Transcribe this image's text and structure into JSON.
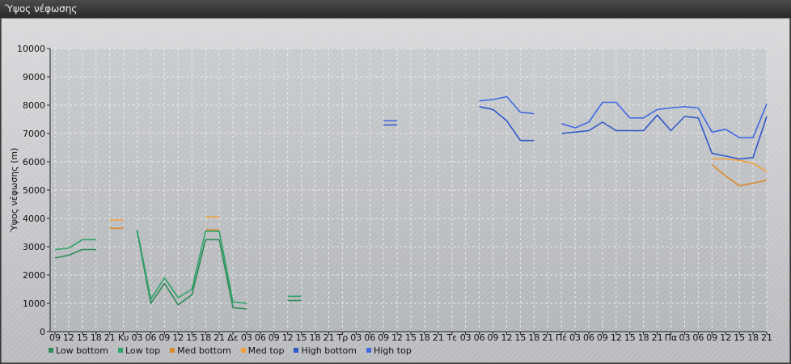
{
  "window": {
    "title": "Ύψος νέφωσης"
  },
  "chart_data": {
    "type": "line",
    "title": "",
    "ylabel": "Ύψος νέφωσης (m)",
    "xlabel": "",
    "ylim": [
      0,
      10000
    ],
    "yticks": [
      0,
      1000,
      2000,
      3000,
      4000,
      5000,
      6000,
      7000,
      8000,
      9000,
      10000
    ],
    "grid": true,
    "legend_position": "bottom-left",
    "x_labels": [
      "09",
      "12",
      "15",
      "18",
      "21",
      "Κυ",
      "03",
      "06",
      "09",
      "12",
      "15",
      "18",
      "21",
      "Δε",
      "03",
      "06",
      "09",
      "12",
      "15",
      "18",
      "21",
      "Τρ",
      "03",
      "06",
      "09",
      "12",
      "15",
      "18",
      "21",
      "Τε",
      "03",
      "06",
      "09",
      "12",
      "15",
      "18",
      "21",
      "Πέ",
      "03",
      "06",
      "09",
      "12",
      "15",
      "18",
      "21",
      "Πα",
      "03",
      "06",
      "09",
      "12",
      "15",
      "18",
      "21"
    ],
    "series": [
      {
        "name": "Low bottom",
        "color": "#2e8b57",
        "values": [
          2600,
          2700,
          2900,
          2900,
          null,
          null,
          3550,
          1000,
          1700,
          950,
          1300,
          3250,
          3250,
          850,
          800,
          null,
          null,
          1100,
          1100,
          null,
          null,
          null,
          null,
          null,
          null,
          null,
          null,
          null,
          null,
          null,
          null,
          null,
          null,
          null,
          null,
          null,
          null,
          null,
          null,
          null,
          null,
          null,
          null,
          null,
          null,
          null,
          null,
          null,
          null,
          null,
          null,
          null,
          null
        ]
      },
      {
        "name": "Low top",
        "color": "#2ea36a",
        "values": [
          2900,
          2950,
          3250,
          3250,
          null,
          null,
          3600,
          1150,
          1900,
          1200,
          1500,
          3550,
          3550,
          1050,
          1000,
          null,
          null,
          1250,
          1250,
          null,
          null,
          null,
          null,
          null,
          null,
          null,
          null,
          null,
          null,
          null,
          null,
          null,
          null,
          null,
          null,
          null,
          null,
          null,
          null,
          null,
          null,
          null,
          null,
          null,
          null,
          null,
          null,
          null,
          null,
          null,
          null,
          null,
          null
        ]
      },
      {
        "name": "Med bottom",
        "color": "#d98a2b",
        "values": [
          null,
          null,
          null,
          null,
          3650,
          3650,
          null,
          null,
          null,
          null,
          null,
          3600,
          3600,
          null,
          null,
          null,
          null,
          null,
          null,
          null,
          null,
          null,
          null,
          null,
          null,
          null,
          null,
          null,
          null,
          null,
          null,
          null,
          null,
          null,
          null,
          null,
          null,
          null,
          null,
          null,
          null,
          null,
          null,
          null,
          null,
          null,
          null,
          null,
          5900,
          5500,
          5150,
          5250,
          5350
        ]
      },
      {
        "name": "Med top",
        "color": "#f0a040",
        "values": [
          null,
          null,
          null,
          null,
          3950,
          3950,
          null,
          null,
          null,
          null,
          null,
          4050,
          4050,
          null,
          null,
          null,
          null,
          null,
          null,
          null,
          null,
          null,
          null,
          null,
          null,
          null,
          null,
          null,
          null,
          null,
          null,
          null,
          null,
          null,
          null,
          null,
          null,
          null,
          null,
          null,
          null,
          null,
          null,
          null,
          null,
          null,
          null,
          null,
          6100,
          6100,
          6050,
          5950,
          5650
        ]
      },
      {
        "name": "High bottom",
        "color": "#2f57c8",
        "values": [
          null,
          null,
          null,
          null,
          null,
          null,
          null,
          null,
          null,
          null,
          null,
          null,
          null,
          null,
          null,
          null,
          null,
          null,
          null,
          null,
          null,
          null,
          null,
          null,
          7300,
          7300,
          null,
          null,
          null,
          null,
          null,
          7950,
          7850,
          7450,
          6750,
          6750,
          null,
          7000,
          7050,
          7100,
          7400,
          7100,
          7100,
          7100,
          7650,
          7100,
          7600,
          7550,
          6300,
          6200,
          6100,
          6150,
          7600
        ]
      },
      {
        "name": "High top",
        "color": "#4169e1",
        "values": [
          null,
          null,
          null,
          null,
          null,
          null,
          null,
          null,
          null,
          null,
          null,
          null,
          null,
          null,
          null,
          null,
          null,
          null,
          null,
          null,
          null,
          null,
          null,
          null,
          7450,
          7450,
          null,
          null,
          null,
          null,
          null,
          8150,
          8200,
          8300,
          7750,
          7700,
          null,
          7350,
          7200,
          7400,
          8100,
          8100,
          7550,
          7550,
          7850,
          7900,
          7950,
          7900,
          7050,
          7150,
          6850,
          6850,
          8050
        ]
      }
    ]
  }
}
